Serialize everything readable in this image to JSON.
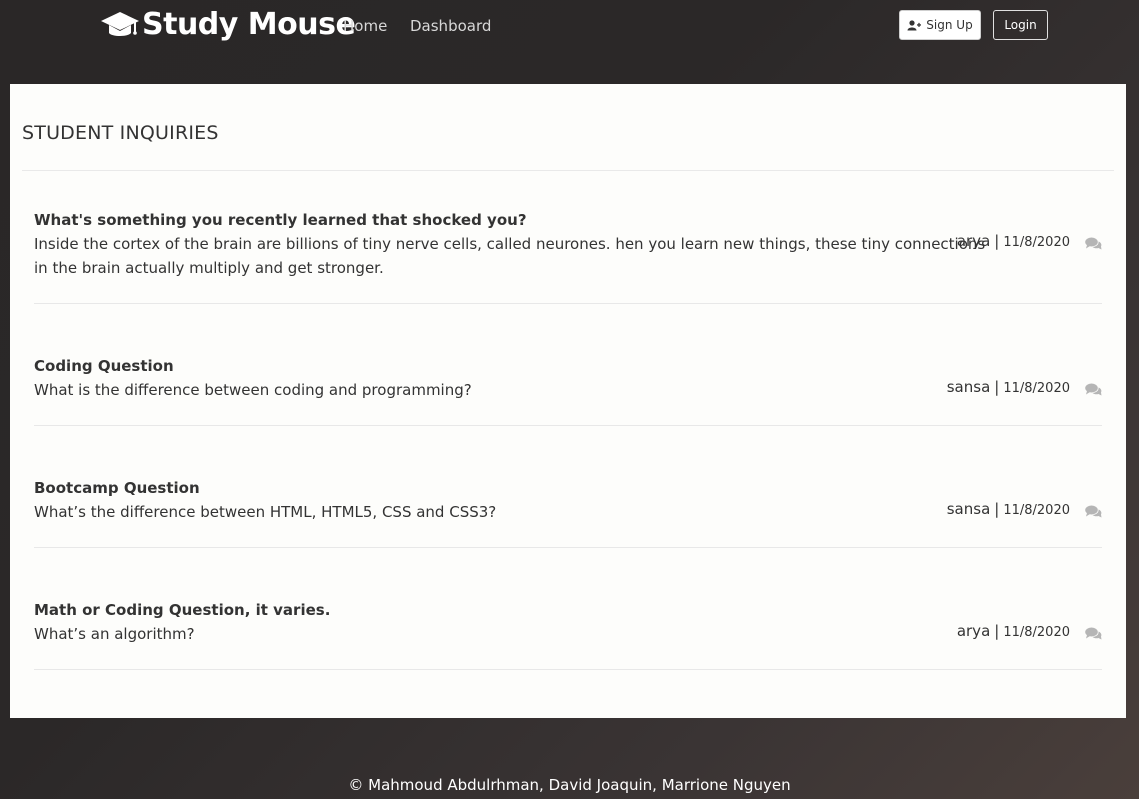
{
  "navbar": {
    "brand": "Study Mouse",
    "brand_icon": "graduation-cap-icon",
    "links": [
      {
        "label": "Home"
      },
      {
        "label": "Dashboard"
      }
    ],
    "signup_label": "Sign Up",
    "signup_icon": "user-plus-icon",
    "login_label": "Login"
  },
  "panel": {
    "title": "STUDENT INQUIRIES",
    "inquiries": [
      {
        "title": "What's something you recently learned that shocked you?",
        "body": "Inside the cortex of the brain are billions of tiny nerve cells, called neurones. hen you learn new things, these tiny connections in the brain actually multiply and get stronger.",
        "author": "arya",
        "separator": "|",
        "date": "11/8/2020",
        "icon": "comments-icon"
      },
      {
        "title": "Coding Question",
        "body": "What is the difference between coding and programming?",
        "author": "sansa",
        "separator": "|",
        "date": "11/8/2020",
        "icon": "comments-icon"
      },
      {
        "title": "Bootcamp Question",
        "body": "What’s the difference between HTML, HTML5, CSS and CSS3?",
        "author": "sansa",
        "separator": "|",
        "date": "11/8/2020",
        "icon": "comments-icon"
      },
      {
        "title": "Math or Coding Question, it varies.",
        "body": "What’s an algorithm?",
        "author": "arya",
        "separator": "|",
        "date": "11/8/2020",
        "icon": "comments-icon"
      }
    ]
  },
  "footer": {
    "copyright": "© Mahmoud Abdulrhman, David Joaquin, Marrione Nguyen"
  },
  "colors": {
    "background": "#2b2828",
    "panel": "#fdfdfb",
    "text": "#333333",
    "icon_gray": "#b5b5b5"
  }
}
